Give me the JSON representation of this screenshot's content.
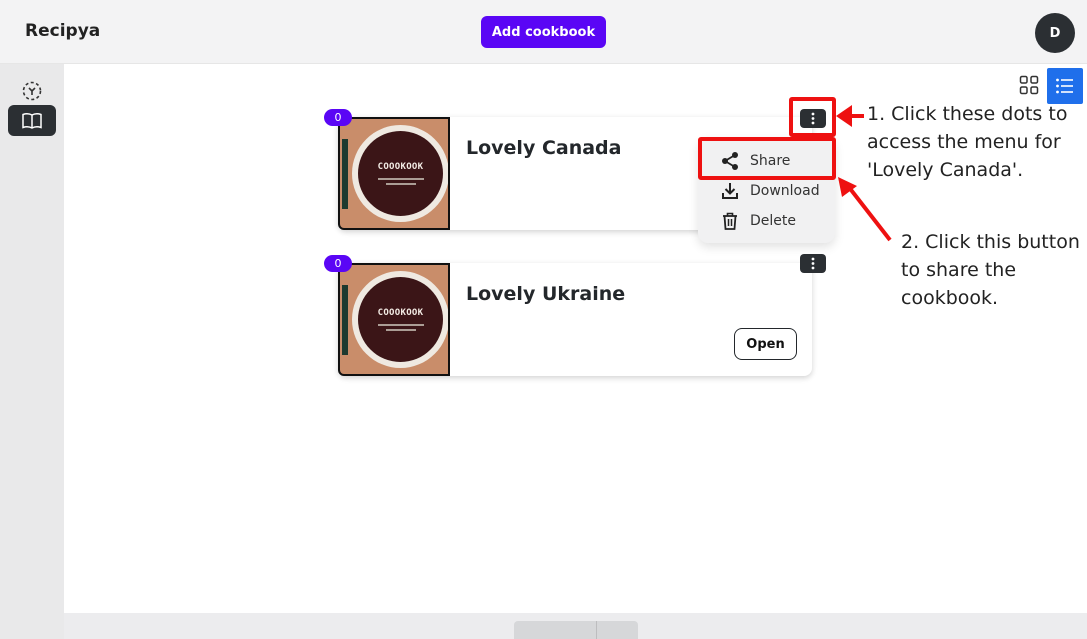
{
  "app": {
    "brand": "Recipya",
    "avatar_initial": "D"
  },
  "header": {
    "add_cookbook_label": "Add cookbook"
  },
  "cookbooks": [
    {
      "title": "Lovely Canada",
      "count": "0",
      "cover_text": "COOOKOOK"
    },
    {
      "title": "Lovely Ukraine",
      "count": "0",
      "cover_text": "COOOKOOK",
      "open_label": "Open"
    }
  ],
  "menu": {
    "items": [
      {
        "label": "Share",
        "icon": "share-icon"
      },
      {
        "label": "Download",
        "icon": "download-icon"
      },
      {
        "label": "Delete",
        "icon": "trash-icon"
      }
    ]
  },
  "annotations": {
    "step1": [
      "1. Click these dots to",
      "access the menu for",
      "'Lovely Canada'."
    ],
    "step2": [
      "2. Click this button",
      "to share the",
      "cookbook."
    ]
  },
  "colors": {
    "accent": "#5a06f5",
    "dark": "#2b2f33",
    "view_active": "#1f6feb",
    "highlight": "#ee1111"
  }
}
